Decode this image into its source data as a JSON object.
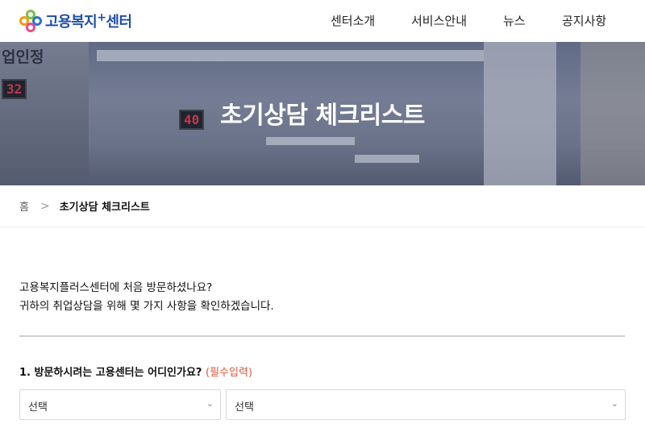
{
  "header": {
    "logo_text": "고용복지",
    "logo_plus": "+",
    "logo_text2": "센터",
    "nav": [
      "센터소개",
      "서비스안내",
      "뉴스",
      "공지사항"
    ]
  },
  "hero": {
    "sign_text": "업인정",
    "led1": "32",
    "led2": "40",
    "title": "초기상담 체크리스트"
  },
  "breadcrumb": {
    "home": "홈",
    "separator": ">",
    "current": "초기상담 체크리스트"
  },
  "intro": {
    "line1": "고용복지플러스센터에 처음 방문하셨나요?",
    "line2": "귀하의 취업상담을 위해 몇 가지 사항을 확인하겠습니다."
  },
  "question1": {
    "label": "1. 방문하시려는 고용센터는 어디인가요?",
    "required": "(필수입력)"
  },
  "selects": [
    {
      "value": "선택"
    },
    {
      "value": "선택"
    }
  ],
  "colors": {
    "brand": "#1f4fa8",
    "required": "#e0573a"
  }
}
